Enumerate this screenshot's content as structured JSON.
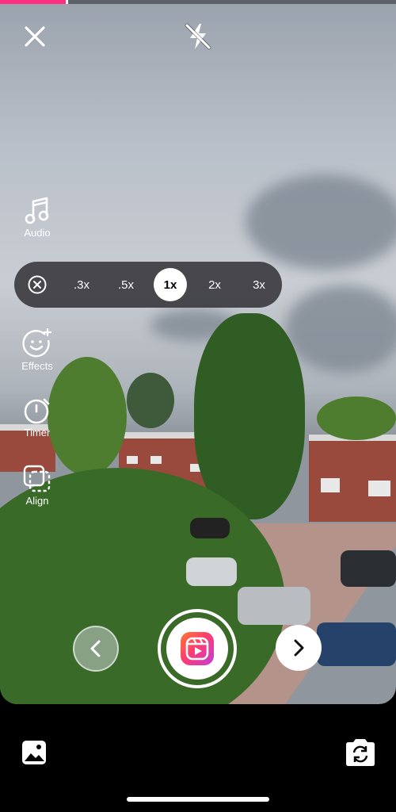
{
  "progress": {
    "fraction": 0.165
  },
  "top_bar": {
    "close_icon": "close-icon",
    "flash_icon": "flash-off-icon"
  },
  "side_tools": [
    {
      "label": "Audio",
      "icon": "music-note-icon"
    },
    {
      "label": "Effects",
      "icon": "sparkle-face-icon"
    },
    {
      "label": "Timer",
      "icon": "timer-icon"
    },
    {
      "label": "Align",
      "icon": "align-icon"
    }
  ],
  "zoom": {
    "options": [
      ".3x",
      ".5x",
      "1x",
      "2x",
      "3x"
    ],
    "selected": "1x",
    "close_icon": "circle-x-icon"
  },
  "bottom": {
    "gallery_icon": "gallery-icon",
    "flip_icon": "flip-camera-icon",
    "shutter_icon": "reels-icon",
    "back_icon": "chevron-left-icon",
    "next_icon": "chevron-right-icon"
  },
  "colors": {
    "accent": "#ff2e7e",
    "zoom_bar": "#3c3c40"
  }
}
